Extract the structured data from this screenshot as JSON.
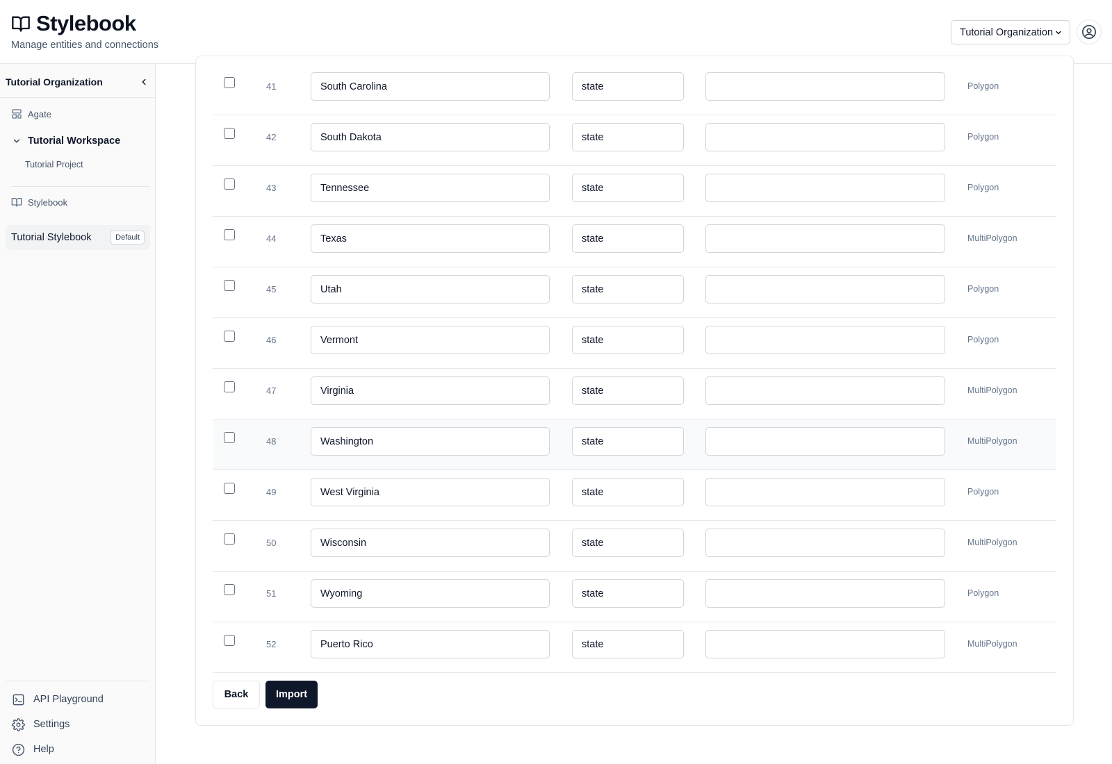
{
  "header": {
    "title": "Stylebook",
    "subtitle": "Manage entities and connections",
    "org_select_value": "Tutorial Organization"
  },
  "sidebar": {
    "org_name": "Tutorial Organization",
    "agate_label": "Agate",
    "workspace_label": "Tutorial Workspace",
    "project_label": "Tutorial Project",
    "stylebook_section_label": "Stylebook",
    "active_stylebook": "Tutorial Stylebook",
    "active_stylebook_badge": "Default",
    "bottom": {
      "api": "API Playground",
      "settings": "Settings",
      "help": "Help"
    }
  },
  "table": {
    "rows": [
      {
        "index": "41",
        "name": "South Carolina",
        "type": "state",
        "extra": "",
        "geometry": "Polygon",
        "checked": false,
        "highlighted": false
      },
      {
        "index": "42",
        "name": "South Dakota",
        "type": "state",
        "extra": "",
        "geometry": "Polygon",
        "checked": false,
        "highlighted": false
      },
      {
        "index": "43",
        "name": "Tennessee",
        "type": "state",
        "extra": "",
        "geometry": "Polygon",
        "checked": false,
        "highlighted": false
      },
      {
        "index": "44",
        "name": "Texas",
        "type": "state",
        "extra": "",
        "geometry": "MultiPolygon",
        "checked": false,
        "highlighted": false
      },
      {
        "index": "45",
        "name": "Utah",
        "type": "state",
        "extra": "",
        "geometry": "Polygon",
        "checked": false,
        "highlighted": false
      },
      {
        "index": "46",
        "name": "Vermont",
        "type": "state",
        "extra": "",
        "geometry": "Polygon",
        "checked": false,
        "highlighted": false
      },
      {
        "index": "47",
        "name": "Virginia",
        "type": "state",
        "extra": "",
        "geometry": "MultiPolygon",
        "checked": false,
        "highlighted": false
      },
      {
        "index": "48",
        "name": "Washington",
        "type": "state",
        "extra": "",
        "geometry": "MultiPolygon",
        "checked": false,
        "highlighted": true
      },
      {
        "index": "49",
        "name": "West Virginia",
        "type": "state",
        "extra": "",
        "geometry": "Polygon",
        "checked": false,
        "highlighted": false
      },
      {
        "index": "50",
        "name": "Wisconsin",
        "type": "state",
        "extra": "",
        "geometry": "MultiPolygon",
        "checked": false,
        "highlighted": false
      },
      {
        "index": "51",
        "name": "Wyoming",
        "type": "state",
        "extra": "",
        "geometry": "Polygon",
        "checked": false,
        "highlighted": false
      },
      {
        "index": "52",
        "name": "Puerto Rico",
        "type": "state",
        "extra": "",
        "geometry": "MultiPolygon",
        "checked": false,
        "highlighted": false
      }
    ]
  },
  "actions": {
    "back_label": "Back",
    "import_label": "Import"
  },
  "colors": {
    "primary": "#0f172a",
    "border": "#e5e7eb",
    "muted_text": "#64748b",
    "highlight_row": "#f8fafc"
  },
  "icons": {
    "logo": "open-book-icon",
    "org_dropdown": "chevron-down-icon",
    "user": "user-circle-icon",
    "collapse_sidebar": "chevron-left-icon",
    "agate": "layout-icon",
    "workspace_toggle": "chevron-down-icon",
    "stylebook": "book-icon",
    "api": "terminal-icon",
    "settings": "gear-icon",
    "help": "help-circle-icon"
  }
}
